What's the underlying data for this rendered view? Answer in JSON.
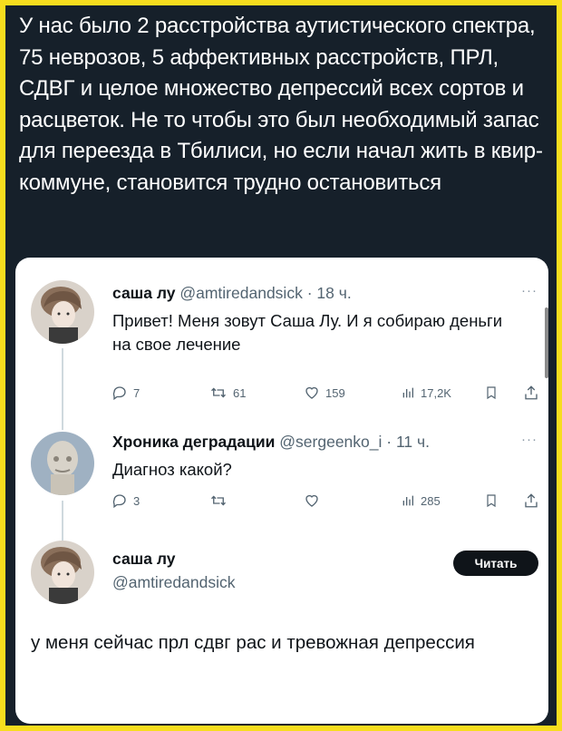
{
  "caption": "У нас было 2 расстройства аутистического спектра, 75 неврозов, 5 аффективных расстройств, ПРЛ, СДВГ и целое множество депрессий всех сортов и расцветок. Не то чтобы это был необходимый запас для переезда в Тбилиси, но если начал жить в квир-коммуне, становится трудно остановиться",
  "colors": {
    "frame": "#f7dd1e",
    "background": "#16202a",
    "card": "#ffffff",
    "secondary_text": "#536471"
  },
  "tweets": [
    {
      "name": "саша лу",
      "handle": "@amtiredandsick",
      "dot": "·",
      "time": "18 ч.",
      "more": "···",
      "text": "Привет! Меня зовут Саша Лу. И я собираю деньги на свое лечение",
      "replies": "7",
      "retweets": "61",
      "likes": "159",
      "views": "17,2K",
      "avatar_icon": "user-avatar"
    },
    {
      "name": "Хроника деградации",
      "handle": "@sergeenko_i",
      "dot": "·",
      "time": "11 ч.",
      "more": "···",
      "text": "Диагноз какой?",
      "replies": "3",
      "retweets": "",
      "likes": "",
      "views": "285",
      "avatar_icon": "user-avatar"
    }
  ],
  "quoted": {
    "name": "саша лу",
    "handle": "@amtiredandsick",
    "read_button": "Читать",
    "text": "у меня сейчас прл сдвг рас и тревожная депрессия"
  }
}
